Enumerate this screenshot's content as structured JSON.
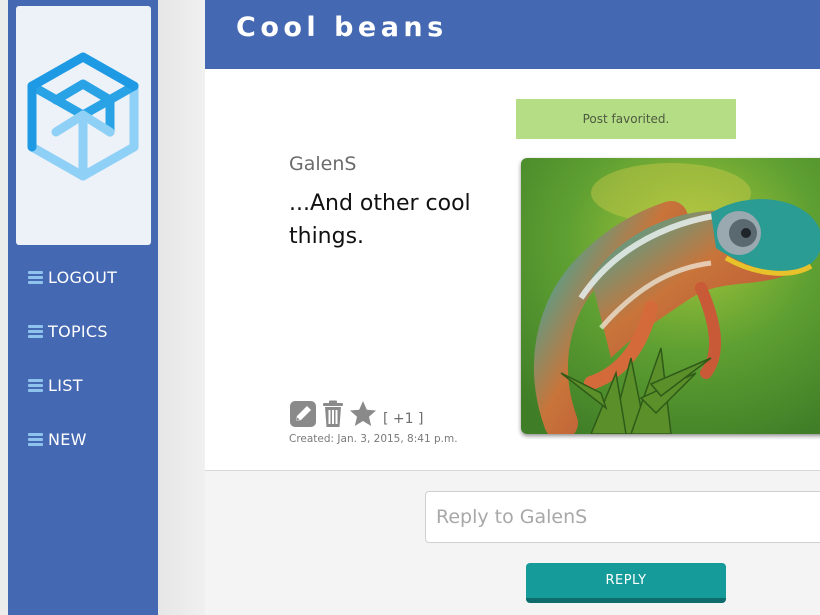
{
  "sidebar": {
    "items": [
      {
        "label": "LOGOUT",
        "icon": "menu-icon"
      },
      {
        "label": "TOPICS",
        "icon": "menu-icon"
      },
      {
        "label": "LIST",
        "icon": "menu-icon"
      },
      {
        "label": "NEW",
        "icon": "menu-icon"
      }
    ]
  },
  "header": {
    "title": "Cool beans"
  },
  "flash": {
    "message": "Post favorited."
  },
  "post": {
    "author": "GalenS",
    "body": "...And other cool things.",
    "image_icon": "chameleon-photo",
    "vote_count": "[ +1 ]",
    "created": "Created: Jan. 3, 2015, 8:41 p.m.",
    "actions": [
      "edit-icon",
      "trash-icon",
      "star-icon"
    ]
  },
  "reply": {
    "placeholder": "Reply to GalenS",
    "button_label": "REPLY"
  },
  "colors": {
    "brand": "#4468b1",
    "flash_bg": "#b5dd86",
    "reply_button": "#169b9b"
  }
}
